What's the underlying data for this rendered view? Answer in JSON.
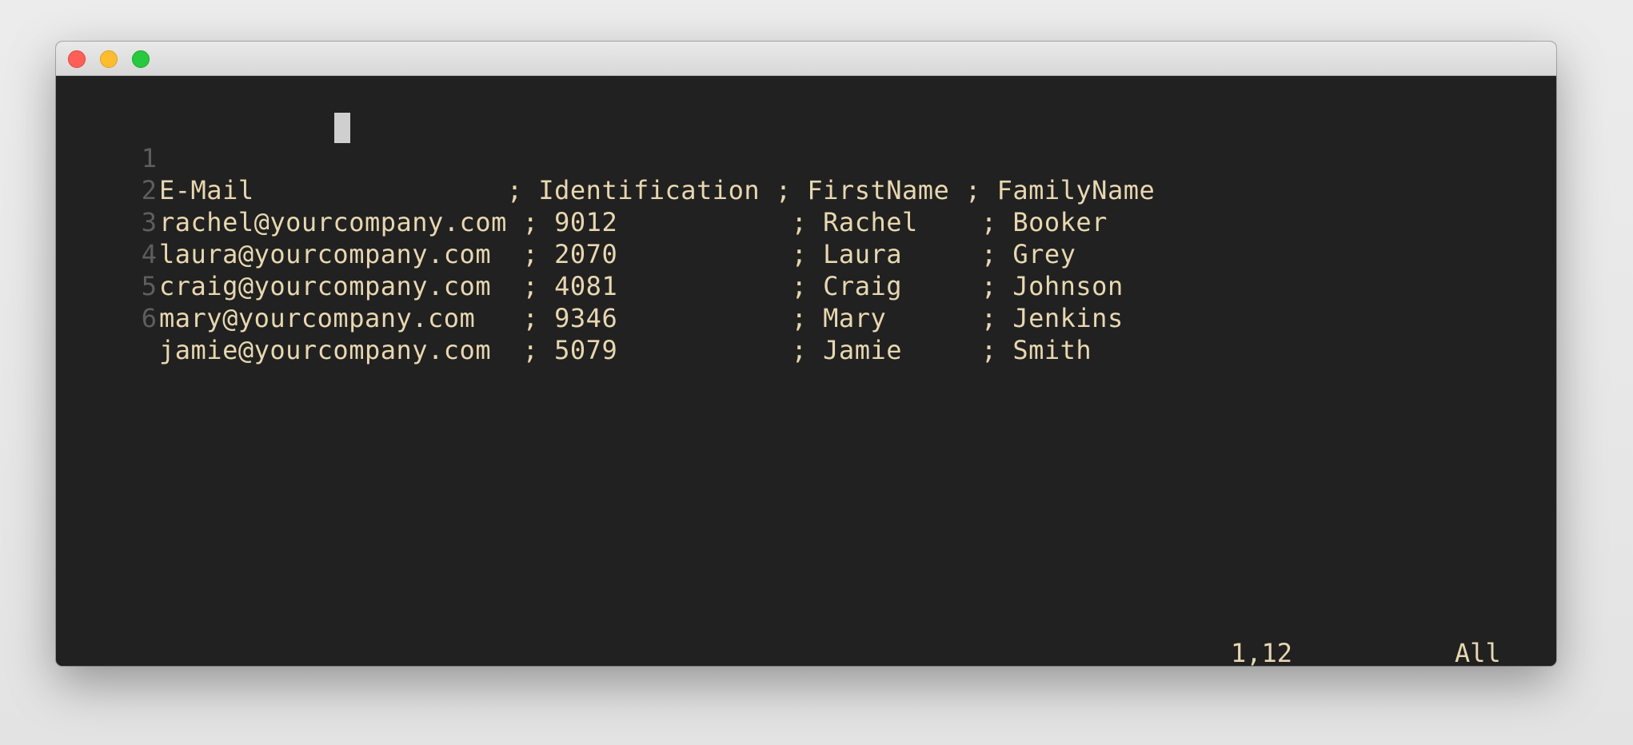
{
  "window": {
    "controls": [
      "close",
      "minimize",
      "zoom"
    ]
  },
  "editor": {
    "lines": [
      {
        "number": "1",
        "text": "E-Mail                ; Identification ; FirstName ; FamilyName"
      },
      {
        "number": "2",
        "text": "rachel@yourcompany.com ; 9012           ; Rachel    ; Booker"
      },
      {
        "number": "3",
        "text": "laura@yourcompany.com  ; 2070           ; Laura     ; Grey"
      },
      {
        "number": "4",
        "text": "craig@yourcompany.com  ; 4081           ; Craig     ; Johnson"
      },
      {
        "number": "5",
        "text": "mary@yourcompany.com   ; 9346           ; Mary      ; Jenkins"
      },
      {
        "number": "6",
        "text": "jamie@yourcompany.com  ; 5079           ; Jamie     ; Smith"
      }
    ],
    "status": {
      "position": "1,12",
      "scroll": "All"
    }
  },
  "colors": {
    "background": "#212121",
    "text": "#e8d7b0",
    "line_number": "#5e5e5e",
    "cursor": "#cfcfcf"
  }
}
